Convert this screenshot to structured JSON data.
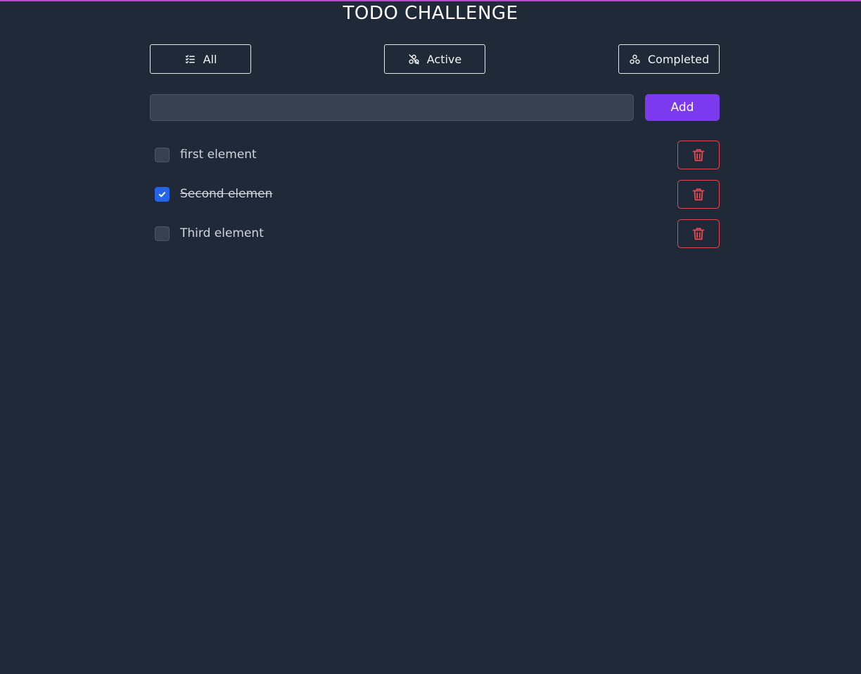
{
  "app": {
    "title": "TODO CHALLENGE"
  },
  "filters": [
    {
      "label": "All",
      "icon": "list-check-icon"
    },
    {
      "label": "Active",
      "icon": "active-filter-icon"
    },
    {
      "label": "Completed",
      "icon": "completed-filter-icon"
    }
  ],
  "new_todo": {
    "value": "",
    "placeholder": "",
    "add_label": "Add"
  },
  "todos": [
    {
      "text": "first element",
      "completed": false
    },
    {
      "text": "Second elemen",
      "completed": true
    },
    {
      "text": "Third element",
      "completed": false
    }
  ],
  "colors": {
    "background": "#202938",
    "accent": "#7b3aed",
    "danger": "#e5484d",
    "checked": "#2563eb"
  }
}
